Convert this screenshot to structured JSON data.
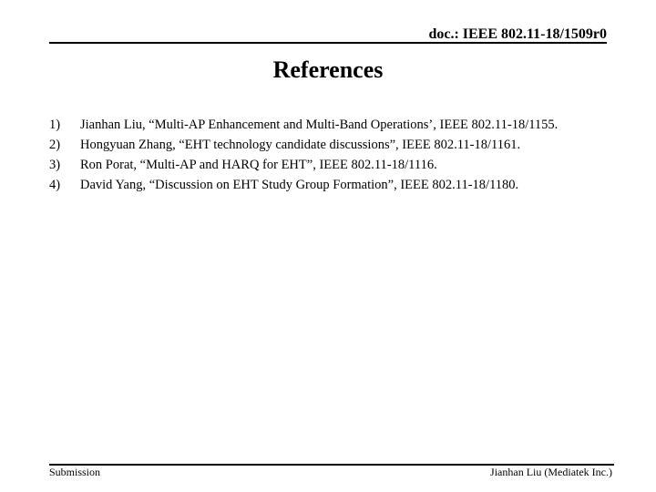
{
  "header": {
    "doc_id": "doc.: IEEE 802.11-18/1509r0"
  },
  "title": "References",
  "references": [
    {
      "num": "1)",
      "text": "Jianhan Liu, “Multi-AP Enhancement and Multi-Band Operations’, IEEE 802.11-18/1155."
    },
    {
      "num": "2)",
      "text": "Hongyuan Zhang, “EHT technology candidate discussions”, IEEE 802.11-18/1161."
    },
    {
      "num": "3)",
      "text": "Ron Porat, “Multi-AP and HARQ for EHT”, IEEE 802.11-18/1116."
    },
    {
      "num": "4)",
      "text": "David Yang, “Discussion on EHT Study Group Formation”, IEEE 802.11-18/1180."
    }
  ],
  "footer": {
    "left": "Submission",
    "right": "Jianhan Liu (Mediatek Inc.)"
  }
}
